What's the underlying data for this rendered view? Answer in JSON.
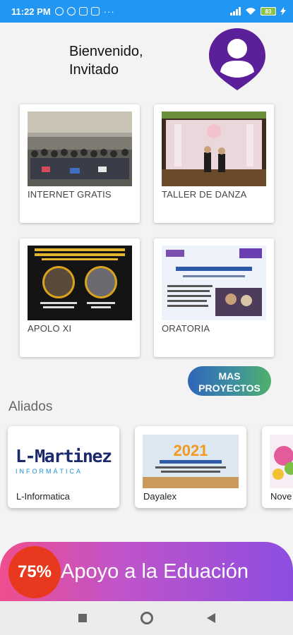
{
  "status_bar": {
    "time": "11:22 PM",
    "overflow": "···",
    "battery": "83",
    "icons": [
      "alarm-icon",
      "app-icon",
      "instagram-icon",
      "instagram-icon",
      "signal-icon",
      "wifi-icon",
      "battery-icon",
      "charging-icon"
    ]
  },
  "header": {
    "welcome_line1": "Bienvenido,",
    "welcome_line2": "Invitado",
    "avatar_icon": "user-location-pin-icon",
    "avatar_color": "#5b1f99"
  },
  "projects": [
    {
      "label": "INTERNET GRATIS",
      "image": "group-photo"
    },
    {
      "label": "TALLER DE DANZA",
      "image": "dance-stage-photo"
    },
    {
      "label": "APOLO XI",
      "image": "event-flyer"
    },
    {
      "label": "ORATORIA",
      "image": "oratory-flyer"
    }
  ],
  "more_button": {
    "line1": "MAS",
    "line2": "PROYECTOS"
  },
  "allies": {
    "title": "Aliados",
    "items": [
      {
        "name": "L-Informatica",
        "logo_main": "L-Martinez",
        "logo_sub": "INFORMÁTICA"
      },
      {
        "name": "Dayalex",
        "logo_main": "2021"
      },
      {
        "name": "Nove"
      }
    ]
  },
  "banner": {
    "badge": "75%",
    "text": "Apoyo a la Eduación"
  },
  "colors": {
    "status_bar": "#2196f3",
    "avatar": "#5b1f99",
    "badge": "#e8391e"
  }
}
